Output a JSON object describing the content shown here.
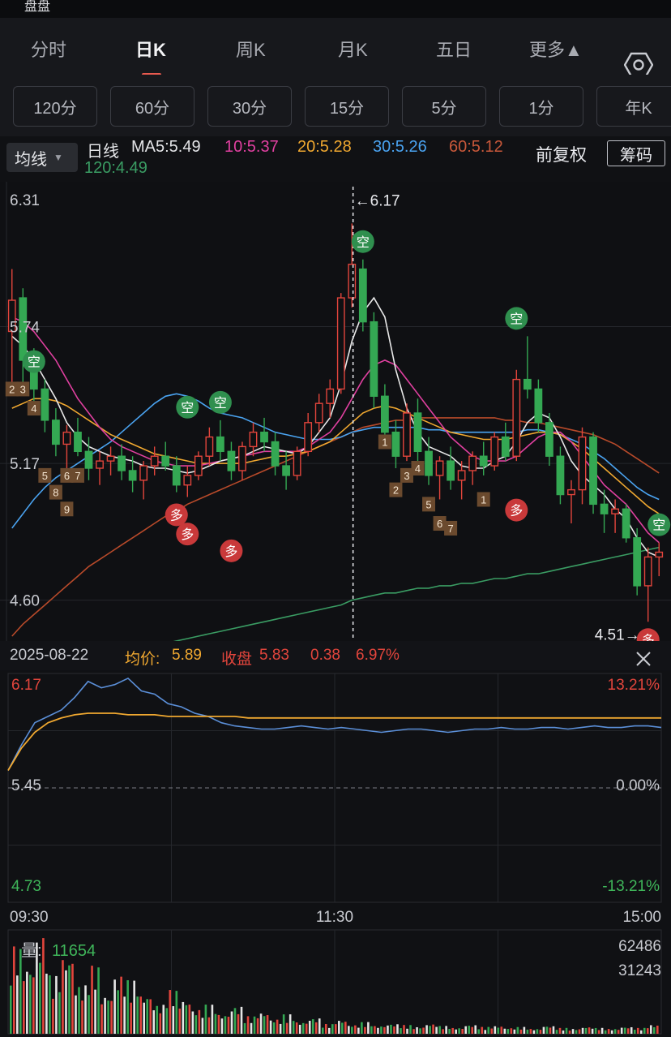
{
  "status_bar": {
    "partial_text": "盘盘"
  },
  "tabs": [
    {
      "label": "分时",
      "active": false
    },
    {
      "label": "日K",
      "active": true
    },
    {
      "label": "周K",
      "active": false
    },
    {
      "label": "月K",
      "active": false
    },
    {
      "label": "五日",
      "active": false
    },
    {
      "label": "更多▲",
      "active": false
    }
  ],
  "periods": [
    "120分",
    "60分",
    "30分",
    "15分",
    "5分",
    "1分",
    "年K"
  ],
  "ma_selector": {
    "label": "均线",
    "arrow": "▼"
  },
  "legend": {
    "kind": "日线",
    "ma5": "MA5:5.49",
    "ma10": "10:5.37",
    "ma20": "20:5.28",
    "ma30": "30:5.26",
    "ma60": "60:5.12",
    "ma120": "120:4.49",
    "adjust": "前复权",
    "chips": "筹码"
  },
  "colors": {
    "up": "#e2453c",
    "down": "#34a853",
    "ma5": "#e8e8e8",
    "ma10": "#e040a0",
    "ma20": "#f0a830",
    "ma30": "#4aa3f0",
    "ma60": "#b84a2a",
    "ma120": "#3a9c63"
  },
  "kline": {
    "y_labels": [
      "6.31",
      "5.74",
      "5.17",
      "4.60"
    ],
    "high_label": "←6.17",
    "low_label": "4.51→",
    "signals": {
      "sell_text": "空",
      "buy_text": "多",
      "numbers": [
        "1",
        "2",
        "3",
        "4",
        "5",
        "6",
        "7",
        "8",
        "9"
      ]
    }
  },
  "chart_data": {
    "type": "candlestick",
    "y_range": [
      4.45,
      6.31
    ],
    "high": 6.17,
    "low": 4.51,
    "ohlc": [
      [
        5.72,
        5.98,
        5.5,
        5.85
      ],
      [
        5.86,
        5.9,
        5.5,
        5.6
      ],
      [
        5.6,
        5.65,
        5.4,
        5.48
      ],
      [
        5.48,
        5.52,
        5.3,
        5.35
      ],
      [
        5.35,
        5.4,
        5.2,
        5.25
      ],
      [
        5.25,
        5.33,
        5.15,
        5.3
      ],
      [
        5.3,
        5.36,
        5.2,
        5.22
      ],
      [
        5.22,
        5.28,
        5.1,
        5.15
      ],
      [
        5.15,
        5.22,
        5.08,
        5.18
      ],
      [
        5.18,
        5.24,
        5.12,
        5.2
      ],
      [
        5.2,
        5.25,
        5.1,
        5.14
      ],
      [
        5.14,
        5.2,
        5.05,
        5.1
      ],
      [
        5.1,
        5.18,
        5.02,
        5.16
      ],
      [
        5.16,
        5.24,
        5.12,
        5.2
      ],
      [
        5.2,
        5.26,
        5.14,
        5.16
      ],
      [
        5.16,
        5.2,
        5.05,
        5.08
      ],
      [
        5.08,
        5.16,
        5.03,
        5.12
      ],
      [
        5.12,
        5.22,
        5.1,
        5.2
      ],
      [
        5.2,
        5.32,
        5.16,
        5.28
      ],
      [
        5.28,
        5.35,
        5.18,
        5.22
      ],
      [
        5.22,
        5.26,
        5.1,
        5.14
      ],
      [
        5.14,
        5.26,
        5.1,
        5.24
      ],
      [
        5.24,
        5.34,
        5.2,
        5.3
      ],
      [
        5.3,
        5.36,
        5.22,
        5.26
      ],
      [
        5.26,
        5.3,
        5.12,
        5.16
      ],
      [
        5.16,
        5.22,
        5.06,
        5.12
      ],
      [
        5.12,
        5.24,
        5.1,
        5.22
      ],
      [
        5.22,
        5.38,
        5.2,
        5.34
      ],
      [
        5.34,
        5.46,
        5.3,
        5.42
      ],
      [
        5.42,
        5.52,
        5.36,
        5.48
      ],
      [
        5.48,
        5.88,
        5.46,
        5.86
      ],
      [
        5.86,
        6.17,
        5.82,
        6.0
      ],
      [
        5.98,
        6.02,
        5.72,
        5.76
      ],
      [
        5.76,
        5.8,
        5.4,
        5.45
      ],
      [
        5.45,
        5.5,
        5.26,
        5.3
      ],
      [
        5.3,
        5.35,
        5.15,
        5.2
      ],
      [
        5.2,
        5.42,
        5.18,
        5.38
      ],
      [
        5.38,
        5.44,
        5.16,
        5.22
      ],
      [
        5.22,
        5.28,
        5.08,
        5.12
      ],
      [
        5.12,
        5.2,
        5.02,
        5.18
      ],
      [
        5.18,
        5.24,
        5.06,
        5.1
      ],
      [
        5.1,
        5.18,
        5.02,
        5.14
      ],
      [
        5.14,
        5.22,
        5.08,
        5.2
      ],
      [
        5.2,
        5.26,
        5.12,
        5.16
      ],
      [
        5.16,
        5.3,
        5.14,
        5.28
      ],
      [
        5.28,
        5.34,
        5.18,
        5.2
      ],
      [
        5.2,
        5.56,
        5.18,
        5.52
      ],
      [
        5.52,
        5.7,
        5.44,
        5.48
      ],
      [
        5.48,
        5.52,
        5.3,
        5.34
      ],
      [
        5.34,
        5.38,
        5.16,
        5.2
      ],
      [
        5.2,
        5.24,
        5.0,
        5.04
      ],
      [
        5.04,
        5.1,
        4.92,
        5.06
      ],
      [
        5.06,
        5.32,
        5.0,
        5.28
      ],
      [
        5.28,
        5.3,
        4.96,
        5.0
      ],
      [
        5.0,
        5.06,
        4.88,
        4.96
      ],
      [
        4.96,
        5.02,
        4.88,
        4.98
      ],
      [
        4.98,
        5.0,
        4.84,
        4.86
      ],
      [
        4.86,
        4.9,
        4.62,
        4.66
      ],
      [
        4.66,
        4.82,
        4.51,
        4.78
      ],
      [
        4.78,
        4.84,
        4.7,
        4.8
      ]
    ],
    "ma5": [
      5.7,
      5.66,
      5.6,
      5.52,
      5.44,
      5.34,
      5.28,
      5.24,
      5.22,
      5.2,
      5.19,
      5.18,
      5.16,
      5.15,
      5.15,
      5.14,
      5.13,
      5.14,
      5.16,
      5.18,
      5.19,
      5.2,
      5.22,
      5.24,
      5.23,
      5.22,
      5.21,
      5.24,
      5.3,
      5.36,
      5.5,
      5.68,
      5.8,
      5.86,
      5.78,
      5.56,
      5.4,
      5.3,
      5.24,
      5.22,
      5.2,
      5.16,
      5.15,
      5.15,
      5.18,
      5.2,
      5.26,
      5.34,
      5.38,
      5.36,
      5.28,
      5.18,
      5.12,
      5.08,
      5.04,
      4.98,
      4.94,
      4.86,
      4.8,
      4.78
    ],
    "ma10": [
      5.78,
      5.76,
      5.72,
      5.66,
      5.6,
      5.52,
      5.44,
      5.38,
      5.32,
      5.27,
      5.24,
      5.22,
      5.2,
      5.18,
      5.17,
      5.16,
      5.16,
      5.16,
      5.17,
      5.18,
      5.19,
      5.2,
      5.21,
      5.22,
      5.22,
      5.22,
      5.22,
      5.24,
      5.27,
      5.3,
      5.36,
      5.44,
      5.52,
      5.58,
      5.6,
      5.58,
      5.52,
      5.46,
      5.4,
      5.34,
      5.28,
      5.24,
      5.2,
      5.18,
      5.18,
      5.18,
      5.2,
      5.24,
      5.28,
      5.3,
      5.3,
      5.26,
      5.2,
      5.14,
      5.08,
      5.04,
      5.0,
      4.94,
      4.88,
      4.84
    ],
    "ma20": [
      5.4,
      5.42,
      5.44,
      5.44,
      5.43,
      5.41,
      5.38,
      5.35,
      5.32,
      5.29,
      5.27,
      5.25,
      5.23,
      5.21,
      5.2,
      5.19,
      5.18,
      5.17,
      5.17,
      5.17,
      5.17,
      5.17,
      5.18,
      5.19,
      5.2,
      5.2,
      5.21,
      5.22,
      5.24,
      5.26,
      5.3,
      5.34,
      5.38,
      5.4,
      5.41,
      5.4,
      5.38,
      5.36,
      5.34,
      5.32,
      5.3,
      5.29,
      5.28,
      5.27,
      5.27,
      5.27,
      5.28,
      5.29,
      5.3,
      5.3,
      5.29,
      5.26,
      5.23,
      5.19,
      5.15,
      5.11,
      5.07,
      5.03,
      4.99,
      4.96
    ],
    "ma30": [
      4.9,
      4.96,
      5.02,
      5.07,
      5.11,
      5.14,
      5.17,
      5.2,
      5.23,
      5.26,
      5.3,
      5.34,
      5.38,
      5.42,
      5.45,
      5.46,
      5.45,
      5.43,
      5.4,
      5.38,
      5.37,
      5.36,
      5.34,
      5.32,
      5.3,
      5.29,
      5.28,
      5.27,
      5.27,
      5.27,
      5.28,
      5.3,
      5.31,
      5.32,
      5.32,
      5.32,
      5.32,
      5.32,
      5.31,
      5.31,
      5.3,
      5.3,
      5.3,
      5.3,
      5.3,
      5.3,
      5.3,
      5.31,
      5.31,
      5.3,
      5.29,
      5.27,
      5.25,
      5.22,
      5.19,
      5.15,
      5.11,
      5.07,
      5.04,
      5.02
    ],
    "ma60": [
      4.45,
      4.5,
      4.54,
      4.58,
      4.62,
      4.66,
      4.7,
      4.74,
      4.77,
      4.8,
      4.83,
      4.86,
      4.89,
      4.92,
      4.95,
      4.97,
      5.0,
      5.02,
      5.04,
      5.06,
      5.08,
      5.1,
      5.12,
      5.14,
      5.16,
      5.18,
      5.2,
      5.22,
      5.24,
      5.26,
      5.28,
      5.3,
      5.32,
      5.33,
      5.34,
      5.35,
      5.35,
      5.36,
      5.36,
      5.36,
      5.36,
      5.36,
      5.36,
      5.36,
      5.36,
      5.35,
      5.35,
      5.34,
      5.34,
      5.33,
      5.32,
      5.31,
      5.3,
      5.29,
      5.27,
      5.25,
      5.22,
      5.19,
      5.16,
      5.13
    ],
    "ma120": [
      4.28,
      4.29,
      4.3,
      4.31,
      4.32,
      4.33,
      4.34,
      4.35,
      4.36,
      4.37,
      4.38,
      4.39,
      4.4,
      4.41,
      4.42,
      4.43,
      4.44,
      4.45,
      4.46,
      4.47,
      4.48,
      4.49,
      4.5,
      4.51,
      4.52,
      4.53,
      4.54,
      4.55,
      4.56,
      4.57,
      4.58,
      4.6,
      4.61,
      4.62,
      4.63,
      4.63,
      4.64,
      4.65,
      4.65,
      4.66,
      4.66,
      4.67,
      4.67,
      4.68,
      4.69,
      4.69,
      4.7,
      4.71,
      4.71,
      4.72,
      4.73,
      4.74,
      4.75,
      4.76,
      4.77,
      4.78,
      4.79,
      4.8,
      4.81,
      4.82
    ]
  },
  "info_bar": {
    "date": "2025-08-22",
    "avg_label": "均价:",
    "avg": "5.89",
    "close_label": "收盘",
    "close": "5.83",
    "change": "0.38",
    "pct": "6.97%"
  },
  "intraday": {
    "top_price": "6.17",
    "top_pct": "13.21%",
    "mid_price": "5.45",
    "mid_pct": "0.00%",
    "bottom_price": "4.73",
    "bottom_pct": "-13.21%",
    "times": [
      "09:30",
      "11:30",
      "15:00"
    ],
    "price_line": [
      5.56,
      5.72,
      5.86,
      5.9,
      5.94,
      6.02,
      6.12,
      6.08,
      6.1,
      6.14,
      6.06,
      6.04,
      5.98,
      5.96,
      5.92,
      5.9,
      5.86,
      5.84,
      5.83,
      5.82,
      5.82,
      5.83,
      5.84,
      5.83,
      5.82,
      5.83,
      5.82,
      5.81,
      5.8,
      5.81,
      5.82,
      5.82,
      5.81,
      5.8,
      5.81,
      5.82,
      5.82,
      5.83,
      5.82,
      5.82,
      5.83,
      5.83,
      5.82,
      5.83,
      5.84,
      5.83,
      5.83,
      5.84,
      5.84,
      5.83
    ],
    "avg_line": [
      5.56,
      5.7,
      5.8,
      5.86,
      5.89,
      5.91,
      5.92,
      5.92,
      5.92,
      5.91,
      5.91,
      5.91,
      5.9,
      5.9,
      5.9,
      5.9,
      5.9,
      5.9,
      5.89,
      5.89,
      5.89,
      5.89,
      5.89,
      5.89,
      5.89,
      5.89,
      5.89,
      5.89,
      5.89,
      5.89,
      5.89,
      5.89,
      5.89,
      5.89,
      5.89,
      5.89,
      5.89,
      5.89,
      5.89,
      5.89,
      5.89,
      5.89,
      5.89,
      5.89,
      5.89,
      5.89,
      5.89,
      5.89,
      5.89,
      5.89
    ]
  },
  "volume": {
    "label": "量:",
    "value": "11654",
    "max_label": "62486",
    "mid_label": "31243",
    "bars": [
      0.9,
      0.7,
      1.0,
      0.6,
      0.8,
      0.5,
      0.7,
      0.4,
      0.6,
      0.55,
      0.4,
      0.3,
      0.45,
      0.35,
      0.25,
      0.3,
      0.2,
      0.28,
      0.18,
      0.22,
      0.15,
      0.2,
      0.12,
      0.16,
      0.1,
      0.14,
      0.09,
      0.12,
      0.08,
      0.1,
      0.09,
      0.07,
      0.1,
      0.08,
      0.06,
      0.09,
      0.07,
      0.08,
      0.06,
      0.07,
      0.05,
      0.08,
      0.06,
      0.05,
      0.07,
      0.06,
      0.05,
      0.07,
      0.06,
      0.09
    ]
  }
}
